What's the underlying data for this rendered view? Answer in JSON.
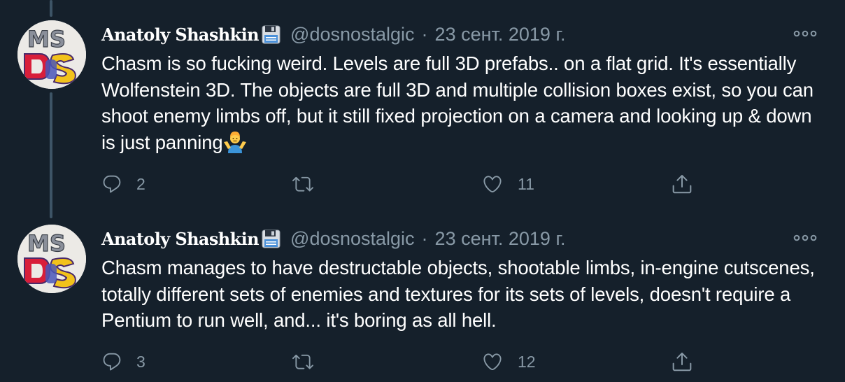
{
  "tweets": [
    {
      "author_name": "Anatoly Shashkin",
      "handle": "@dosnostalgic",
      "separator": "·",
      "date": "23 сент. 2019 г.",
      "text": "Chasm is so fucking weird. Levels are full 3D prefabs.. on a flat grid. It's essentially Wolfenstein 3D. The objects are full 3D and multiple collision boxes exist, so you can shoot enemy limbs off, but it still fixed projection on a camera and looking up & down is just panning",
      "emoji": "person-shrugging-emoji",
      "reply_count": "2",
      "retweet_count": "",
      "like_count": "11"
    },
    {
      "author_name": "Anatoly Shashkin",
      "handle": "@dosnostalgic",
      "separator": "·",
      "date": "23 сент. 2019 г.",
      "text": "Chasm manages to have destructable objects, shootable limbs, in-engine cutscenes, totally different sets of enemies and textures for its sets of levels, doesn't require a Pentium to run well, and... it's boring as all hell.",
      "reply_count": "3",
      "retweet_count": "",
      "like_count": "12"
    }
  ],
  "colors": {
    "background": "#15202b",
    "primary_text": "#ffffff",
    "secondary_text": "#8899a6",
    "thread_line": "#3d5466"
  },
  "icons": {
    "avatar": "ms-dos-logo-avatar",
    "badge": "floppy-disk-icon",
    "more": "more-options-icon",
    "reply": "reply-icon",
    "retweet": "retweet-icon",
    "like": "like-icon",
    "share": "share-icon"
  }
}
